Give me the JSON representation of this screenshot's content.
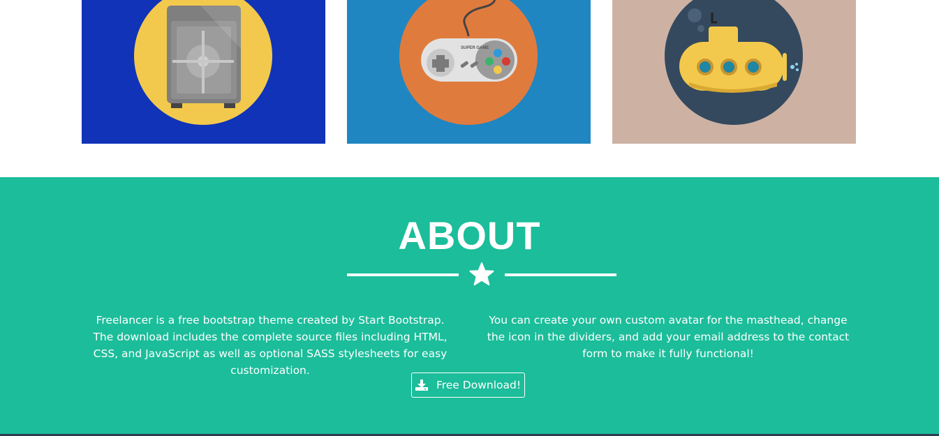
{
  "portfolio": {
    "items": [
      {
        "icon": "safe-icon",
        "background": "#1033b8",
        "circle": "#f2c94c"
      },
      {
        "icon": "game-controller-icon",
        "background": "#1f86c1",
        "circle": "#e07b3e",
        "controller_text": "SUPER GAME"
      },
      {
        "icon": "submarine-icon",
        "background": "#cdb2a4",
        "circle": "#34495e"
      }
    ]
  },
  "about": {
    "title": "ABOUT",
    "divider_icon": "star-icon",
    "left_text": "Freelancer is a free bootstrap theme created by Start Bootstrap. The download includes the complete source files including HTML, CSS, and JavaScript as well as optional SASS stylesheets for easy customization.",
    "right_text": "You can create your own custom avatar for the masthead, change the icon in the dividers, and add your email address to the contact form to make it fully functional!",
    "button_label": "Free Download!",
    "button_icon": "download-icon",
    "background": "#1bbd9a"
  }
}
